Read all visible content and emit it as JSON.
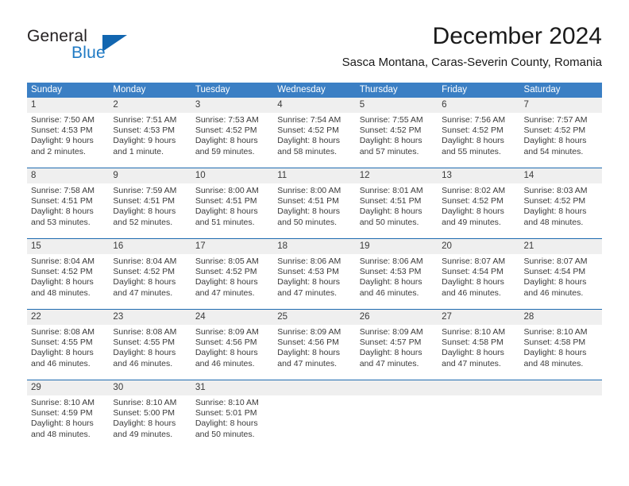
{
  "brand": {
    "name_part1": "General",
    "name_part2": "Blue",
    "flag_icon": "triangle-flag-icon",
    "color_dark": "#231f20",
    "color_blue": "#1f7ac4"
  },
  "header": {
    "month_title": "December 2024",
    "location": "Sasca Montana, Caras-Severin County, Romania"
  },
  "theme": {
    "header_blue": "#3b7fc4",
    "rule_blue": "#1e6bb0",
    "daynum_band": "#efefef",
    "text": "#3a3a3a"
  },
  "weekdays": [
    "Sunday",
    "Monday",
    "Tuesday",
    "Wednesday",
    "Thursday",
    "Friday",
    "Saturday"
  ],
  "weeks": [
    {
      "days": [
        {
          "num": "1",
          "sunrise": "Sunrise: 7:50 AM",
          "sunset": "Sunset: 4:53 PM",
          "daylight1": "Daylight: 9 hours",
          "daylight2": "and 2 minutes."
        },
        {
          "num": "2",
          "sunrise": "Sunrise: 7:51 AM",
          "sunset": "Sunset: 4:53 PM",
          "daylight1": "Daylight: 9 hours",
          "daylight2": "and 1 minute."
        },
        {
          "num": "3",
          "sunrise": "Sunrise: 7:53 AM",
          "sunset": "Sunset: 4:52 PM",
          "daylight1": "Daylight: 8 hours",
          "daylight2": "and 59 minutes."
        },
        {
          "num": "4",
          "sunrise": "Sunrise: 7:54 AM",
          "sunset": "Sunset: 4:52 PM",
          "daylight1": "Daylight: 8 hours",
          "daylight2": "and 58 minutes."
        },
        {
          "num": "5",
          "sunrise": "Sunrise: 7:55 AM",
          "sunset": "Sunset: 4:52 PM",
          "daylight1": "Daylight: 8 hours",
          "daylight2": "and 57 minutes."
        },
        {
          "num": "6",
          "sunrise": "Sunrise: 7:56 AM",
          "sunset": "Sunset: 4:52 PM",
          "daylight1": "Daylight: 8 hours",
          "daylight2": "and 55 minutes."
        },
        {
          "num": "7",
          "sunrise": "Sunrise: 7:57 AM",
          "sunset": "Sunset: 4:52 PM",
          "daylight1": "Daylight: 8 hours",
          "daylight2": "and 54 minutes."
        }
      ]
    },
    {
      "days": [
        {
          "num": "8",
          "sunrise": "Sunrise: 7:58 AM",
          "sunset": "Sunset: 4:51 PM",
          "daylight1": "Daylight: 8 hours",
          "daylight2": "and 53 minutes."
        },
        {
          "num": "9",
          "sunrise": "Sunrise: 7:59 AM",
          "sunset": "Sunset: 4:51 PM",
          "daylight1": "Daylight: 8 hours",
          "daylight2": "and 52 minutes."
        },
        {
          "num": "10",
          "sunrise": "Sunrise: 8:00 AM",
          "sunset": "Sunset: 4:51 PM",
          "daylight1": "Daylight: 8 hours",
          "daylight2": "and 51 minutes."
        },
        {
          "num": "11",
          "sunrise": "Sunrise: 8:00 AM",
          "sunset": "Sunset: 4:51 PM",
          "daylight1": "Daylight: 8 hours",
          "daylight2": "and 50 minutes."
        },
        {
          "num": "12",
          "sunrise": "Sunrise: 8:01 AM",
          "sunset": "Sunset: 4:51 PM",
          "daylight1": "Daylight: 8 hours",
          "daylight2": "and 50 minutes."
        },
        {
          "num": "13",
          "sunrise": "Sunrise: 8:02 AM",
          "sunset": "Sunset: 4:52 PM",
          "daylight1": "Daylight: 8 hours",
          "daylight2": "and 49 minutes."
        },
        {
          "num": "14",
          "sunrise": "Sunrise: 8:03 AM",
          "sunset": "Sunset: 4:52 PM",
          "daylight1": "Daylight: 8 hours",
          "daylight2": "and 48 minutes."
        }
      ]
    },
    {
      "days": [
        {
          "num": "15",
          "sunrise": "Sunrise: 8:04 AM",
          "sunset": "Sunset: 4:52 PM",
          "daylight1": "Daylight: 8 hours",
          "daylight2": "and 48 minutes."
        },
        {
          "num": "16",
          "sunrise": "Sunrise: 8:04 AM",
          "sunset": "Sunset: 4:52 PM",
          "daylight1": "Daylight: 8 hours",
          "daylight2": "and 47 minutes."
        },
        {
          "num": "17",
          "sunrise": "Sunrise: 8:05 AM",
          "sunset": "Sunset: 4:52 PM",
          "daylight1": "Daylight: 8 hours",
          "daylight2": "and 47 minutes."
        },
        {
          "num": "18",
          "sunrise": "Sunrise: 8:06 AM",
          "sunset": "Sunset: 4:53 PM",
          "daylight1": "Daylight: 8 hours",
          "daylight2": "and 47 minutes."
        },
        {
          "num": "19",
          "sunrise": "Sunrise: 8:06 AM",
          "sunset": "Sunset: 4:53 PM",
          "daylight1": "Daylight: 8 hours",
          "daylight2": "and 46 minutes."
        },
        {
          "num": "20",
          "sunrise": "Sunrise: 8:07 AM",
          "sunset": "Sunset: 4:54 PM",
          "daylight1": "Daylight: 8 hours",
          "daylight2": "and 46 minutes."
        },
        {
          "num": "21",
          "sunrise": "Sunrise: 8:07 AM",
          "sunset": "Sunset: 4:54 PM",
          "daylight1": "Daylight: 8 hours",
          "daylight2": "and 46 minutes."
        }
      ]
    },
    {
      "days": [
        {
          "num": "22",
          "sunrise": "Sunrise: 8:08 AM",
          "sunset": "Sunset: 4:55 PM",
          "daylight1": "Daylight: 8 hours",
          "daylight2": "and 46 minutes."
        },
        {
          "num": "23",
          "sunrise": "Sunrise: 8:08 AM",
          "sunset": "Sunset: 4:55 PM",
          "daylight1": "Daylight: 8 hours",
          "daylight2": "and 46 minutes."
        },
        {
          "num": "24",
          "sunrise": "Sunrise: 8:09 AM",
          "sunset": "Sunset: 4:56 PM",
          "daylight1": "Daylight: 8 hours",
          "daylight2": "and 46 minutes."
        },
        {
          "num": "25",
          "sunrise": "Sunrise: 8:09 AM",
          "sunset": "Sunset: 4:56 PM",
          "daylight1": "Daylight: 8 hours",
          "daylight2": "and 47 minutes."
        },
        {
          "num": "26",
          "sunrise": "Sunrise: 8:09 AM",
          "sunset": "Sunset: 4:57 PM",
          "daylight1": "Daylight: 8 hours",
          "daylight2": "and 47 minutes."
        },
        {
          "num": "27",
          "sunrise": "Sunrise: 8:10 AM",
          "sunset": "Sunset: 4:58 PM",
          "daylight1": "Daylight: 8 hours",
          "daylight2": "and 47 minutes."
        },
        {
          "num": "28",
          "sunrise": "Sunrise: 8:10 AM",
          "sunset": "Sunset: 4:58 PM",
          "daylight1": "Daylight: 8 hours",
          "daylight2": "and 48 minutes."
        }
      ]
    },
    {
      "days": [
        {
          "num": "29",
          "sunrise": "Sunrise: 8:10 AM",
          "sunset": "Sunset: 4:59 PM",
          "daylight1": "Daylight: 8 hours",
          "daylight2": "and 48 minutes."
        },
        {
          "num": "30",
          "sunrise": "Sunrise: 8:10 AM",
          "sunset": "Sunset: 5:00 PM",
          "daylight1": "Daylight: 8 hours",
          "daylight2": "and 49 minutes."
        },
        {
          "num": "31",
          "sunrise": "Sunrise: 8:10 AM",
          "sunset": "Sunset: 5:01 PM",
          "daylight1": "Daylight: 8 hours",
          "daylight2": "and 50 minutes."
        },
        {
          "num": "",
          "sunrise": "",
          "sunset": "",
          "daylight1": "",
          "daylight2": ""
        },
        {
          "num": "",
          "sunrise": "",
          "sunset": "",
          "daylight1": "",
          "daylight2": ""
        },
        {
          "num": "",
          "sunrise": "",
          "sunset": "",
          "daylight1": "",
          "daylight2": ""
        },
        {
          "num": "",
          "sunrise": "",
          "sunset": "",
          "daylight1": "",
          "daylight2": ""
        }
      ]
    }
  ]
}
